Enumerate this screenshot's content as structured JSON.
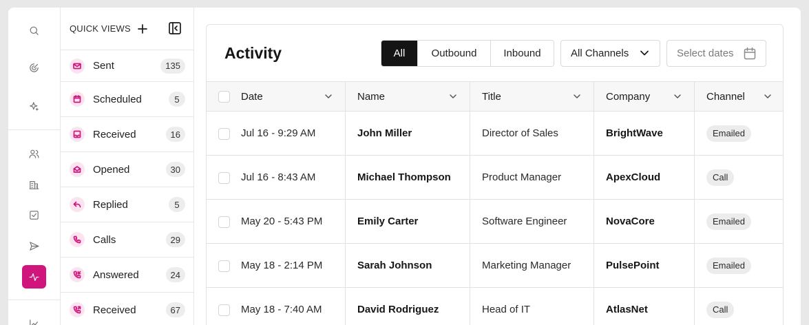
{
  "rail": {
    "icons": [
      "search-icon",
      "target-icon",
      "sparkle-icon",
      "users-icon",
      "building-icon",
      "checkbox-icon",
      "send-icon",
      "activity-icon",
      "chart-icon"
    ],
    "active": "activity-icon",
    "active_color": "#d0157c"
  },
  "quick_views": {
    "title": "QUICK VIEWS",
    "items": [
      {
        "label": "Sent",
        "count": "135",
        "icon": "mail-icon"
      },
      {
        "label": "Scheduled",
        "count": "5",
        "icon": "calendar-icon"
      },
      {
        "label": "Received",
        "count": "16",
        "icon": "inbox-icon"
      },
      {
        "label": "Opened",
        "count": "30",
        "icon": "mail-open-icon"
      },
      {
        "label": "Replied",
        "count": "5",
        "icon": "reply-icon"
      },
      {
        "label": "Calls",
        "count": "29",
        "icon": "phone-icon"
      },
      {
        "label": "Answered",
        "count": "24",
        "icon": "phone-incoming-icon"
      },
      {
        "label": "Received",
        "count": "67",
        "icon": "phone-received-icon"
      }
    ]
  },
  "activity": {
    "title": "Activity",
    "filters": [
      "All",
      "Outbound",
      "Inbound"
    ],
    "active_filter": "All",
    "channel_dropdown": "All Channels",
    "date_placeholder": "Select dates"
  },
  "table": {
    "columns": [
      "Date",
      "Name",
      "Title",
      "Company",
      "Channel"
    ],
    "rows": [
      {
        "date": "Jul 16 - 9:29 AM",
        "name": "John Miller",
        "title": "Director of Sales",
        "company": "BrightWave",
        "channel": "Emailed"
      },
      {
        "date": "Jul 16 - 8:43 AM",
        "name": "Michael Thompson",
        "title": "Product Manager",
        "company": "ApexCloud",
        "channel": "Call"
      },
      {
        "date": "May 20 - 5:43 PM",
        "name": "Emily Carter",
        "title": "Software Engineer",
        "company": "NovaCore",
        "channel": "Emailed"
      },
      {
        "date": "May 18 - 2:14 PM",
        "name": "Sarah Johnson",
        "title": "Marketing Manager",
        "company": "PulsePoint",
        "channel": "Emailed"
      },
      {
        "date": "May 18 - 7:40 AM",
        "name": "David Rodriguez",
        "title": "Head of IT",
        "company": "AtlasNet",
        "channel": "Call"
      }
    ]
  }
}
